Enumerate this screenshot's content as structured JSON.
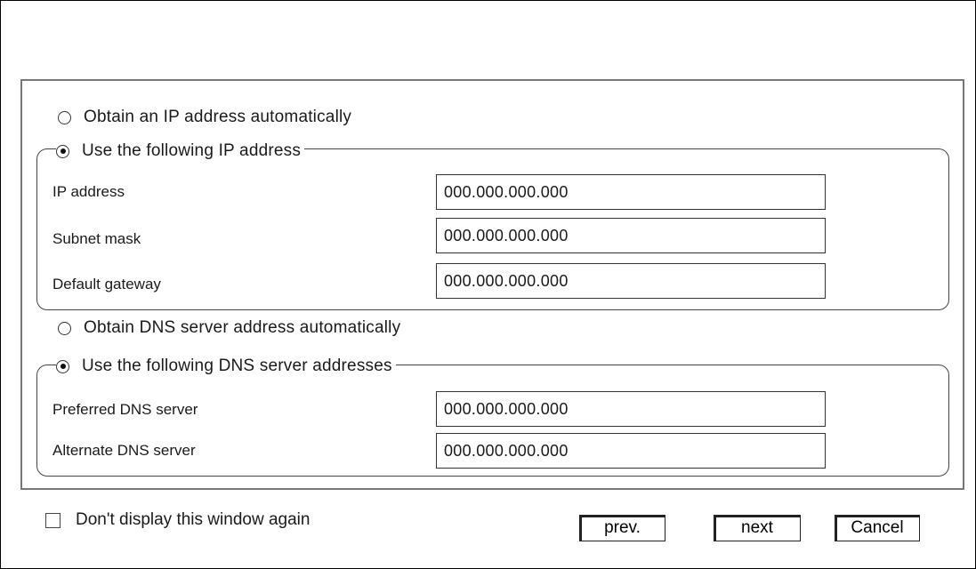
{
  "ip_section": {
    "auto_option": {
      "label": "Obtain an IP address automatically",
      "checked": false
    },
    "manual_option": {
      "label": "Use the following IP address",
      "checked": true
    },
    "fields": [
      {
        "label": "IP address",
        "value": "000.000.000.000"
      },
      {
        "label": "Subnet mask",
        "value": "000.000.000.000"
      },
      {
        "label": "Default gateway",
        "value": "000.000.000.000"
      }
    ]
  },
  "dns_section": {
    "auto_option": {
      "label": "Obtain DNS server address automatically",
      "checked": false
    },
    "manual_option": {
      "label": "Use the following DNS server addresses",
      "checked": true
    },
    "fields": [
      {
        "label": "Preferred DNS server",
        "value": "000.000.000.000"
      },
      {
        "label": "Alternate DNS server",
        "value": "000.000.000.000"
      }
    ]
  },
  "footer": {
    "dont_show_label": "Don't display this window again",
    "dont_show_checked": false,
    "prev_label": "prev.",
    "next_label": "next",
    "cancel_label": "Cancel"
  }
}
